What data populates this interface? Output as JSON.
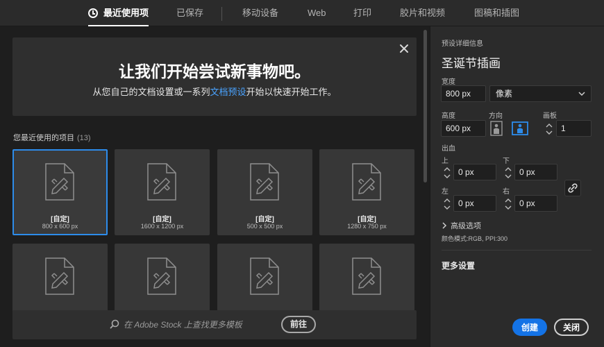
{
  "tabs": [
    {
      "label": "最近使用项",
      "active": true
    },
    {
      "label": "已保存"
    },
    {
      "label": "移动设备"
    },
    {
      "label": "Web"
    },
    {
      "label": "打印"
    },
    {
      "label": "胶片和视频"
    },
    {
      "label": "图稿和插图"
    }
  ],
  "hero": {
    "title": "让我们开始尝试新事物吧。",
    "subtitle_before": "从您自己的文档设置或一系列",
    "subtitle_link": "文档预设",
    "subtitle_after": "开始以快速开始工作。"
  },
  "recent": {
    "title": "您最近使用的项目",
    "count": "(13)",
    "items": [
      {
        "name": "[自定]",
        "size": "800 x 600 px",
        "selected": true
      },
      {
        "name": "[自定]",
        "size": "1600 x 1200 px"
      },
      {
        "name": "[自定]",
        "size": "500 x 500 px"
      },
      {
        "name": "[自定]",
        "size": "1280 x 750 px"
      },
      {
        "name": "",
        "size": ""
      },
      {
        "name": "",
        "size": ""
      },
      {
        "name": "",
        "size": ""
      },
      {
        "name": "",
        "size": ""
      }
    ]
  },
  "search": {
    "placeholder": "在 Adobe Stock 上查找更多模板",
    "go_label": "前往"
  },
  "preset": {
    "section_label": "预设详细信息",
    "name": "圣诞节插画",
    "width_label": "宽度",
    "width_value": "800 px",
    "unit": "像素",
    "height_label": "高度",
    "height_value": "600 px",
    "orientation_label": "方向",
    "artboard_label": "画板",
    "artboard_value": "1",
    "bleed_label": "出血",
    "top_label": "上",
    "top_value": "0 px",
    "bottom_label": "下",
    "bottom_value": "0 px",
    "left_label": "左",
    "left_value": "0 px",
    "right_label": "右",
    "right_value": "0 px",
    "advanced_label": "高级选项",
    "color_mode": "颜色模式:RGB, PPI:300",
    "more_settings": "更多设置"
  },
  "actions": {
    "create": "创建",
    "close": "关闭"
  },
  "colors": {
    "accent": "#1473e6",
    "selection": "#2d8ceb",
    "link": "#4aa3ff"
  }
}
